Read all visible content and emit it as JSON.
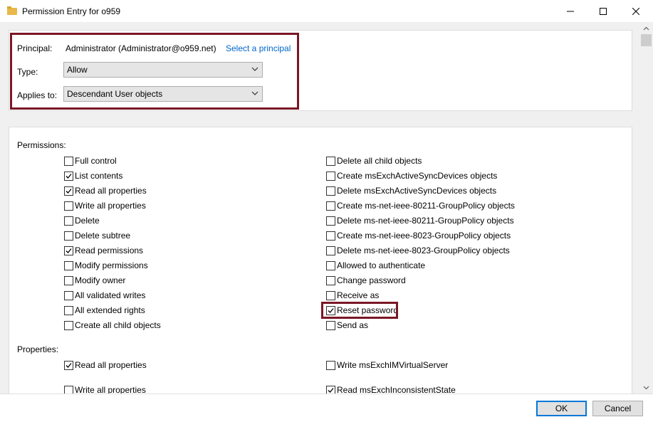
{
  "window": {
    "title": "Permission Entry for o959",
    "folder_icon": "folder-icon",
    "minimize_icon": "minimize-icon",
    "maximize_icon": "maximize-icon",
    "close_icon": "close-icon"
  },
  "principal": {
    "label": "Principal:",
    "value": "Administrator (Administrator@o959.net)",
    "select_link": "Select a principal"
  },
  "type": {
    "label": "Type:",
    "value": "Allow"
  },
  "applies_to": {
    "label": "Applies to:",
    "value": "Descendant User objects"
  },
  "permissions": {
    "heading": "Permissions:",
    "left": [
      {
        "label": "Full control",
        "checked": false
      },
      {
        "label": "List contents",
        "checked": true
      },
      {
        "label": "Read all properties",
        "checked": true
      },
      {
        "label": "Write all properties",
        "checked": false
      },
      {
        "label": "Delete",
        "checked": false
      },
      {
        "label": "Delete subtree",
        "checked": false
      },
      {
        "label": "Read permissions",
        "checked": true
      },
      {
        "label": "Modify permissions",
        "checked": false
      },
      {
        "label": "Modify owner",
        "checked": false
      },
      {
        "label": "All validated writes",
        "checked": false
      },
      {
        "label": "All extended rights",
        "checked": false
      },
      {
        "label": "Create all child objects",
        "checked": false
      }
    ],
    "right": [
      {
        "label": "Delete all child objects",
        "checked": false
      },
      {
        "label": "Create msExchActiveSyncDevices objects",
        "checked": false
      },
      {
        "label": "Delete msExchActiveSyncDevices objects",
        "checked": false
      },
      {
        "label": "Create ms-net-ieee-80211-GroupPolicy objects",
        "checked": false
      },
      {
        "label": "Delete ms-net-ieee-80211-GroupPolicy objects",
        "checked": false
      },
      {
        "label": "Create ms-net-ieee-8023-GroupPolicy objects",
        "checked": false
      },
      {
        "label": "Delete ms-net-ieee-8023-GroupPolicy objects",
        "checked": false
      },
      {
        "label": "Allowed to authenticate",
        "checked": false
      },
      {
        "label": "Change password",
        "checked": false
      },
      {
        "label": "Receive as",
        "checked": false
      },
      {
        "label": "Reset password",
        "checked": true
      },
      {
        "label": "Send as",
        "checked": false
      }
    ]
  },
  "properties": {
    "heading": "Properties:",
    "left": [
      {
        "label": "Read all properties",
        "checked": true
      },
      {
        "label": "Write all properties",
        "checked": false
      }
    ],
    "right": [
      {
        "label": "Write msExchIMVirtualServer",
        "checked": false
      },
      {
        "label": "Read msExchInconsistentState",
        "checked": true
      }
    ]
  },
  "buttons": {
    "ok": "OK",
    "cancel": "Cancel"
  },
  "colors": {
    "highlight": "#7a1726",
    "link": "#0066cc",
    "ok_border": "#0078d7"
  }
}
